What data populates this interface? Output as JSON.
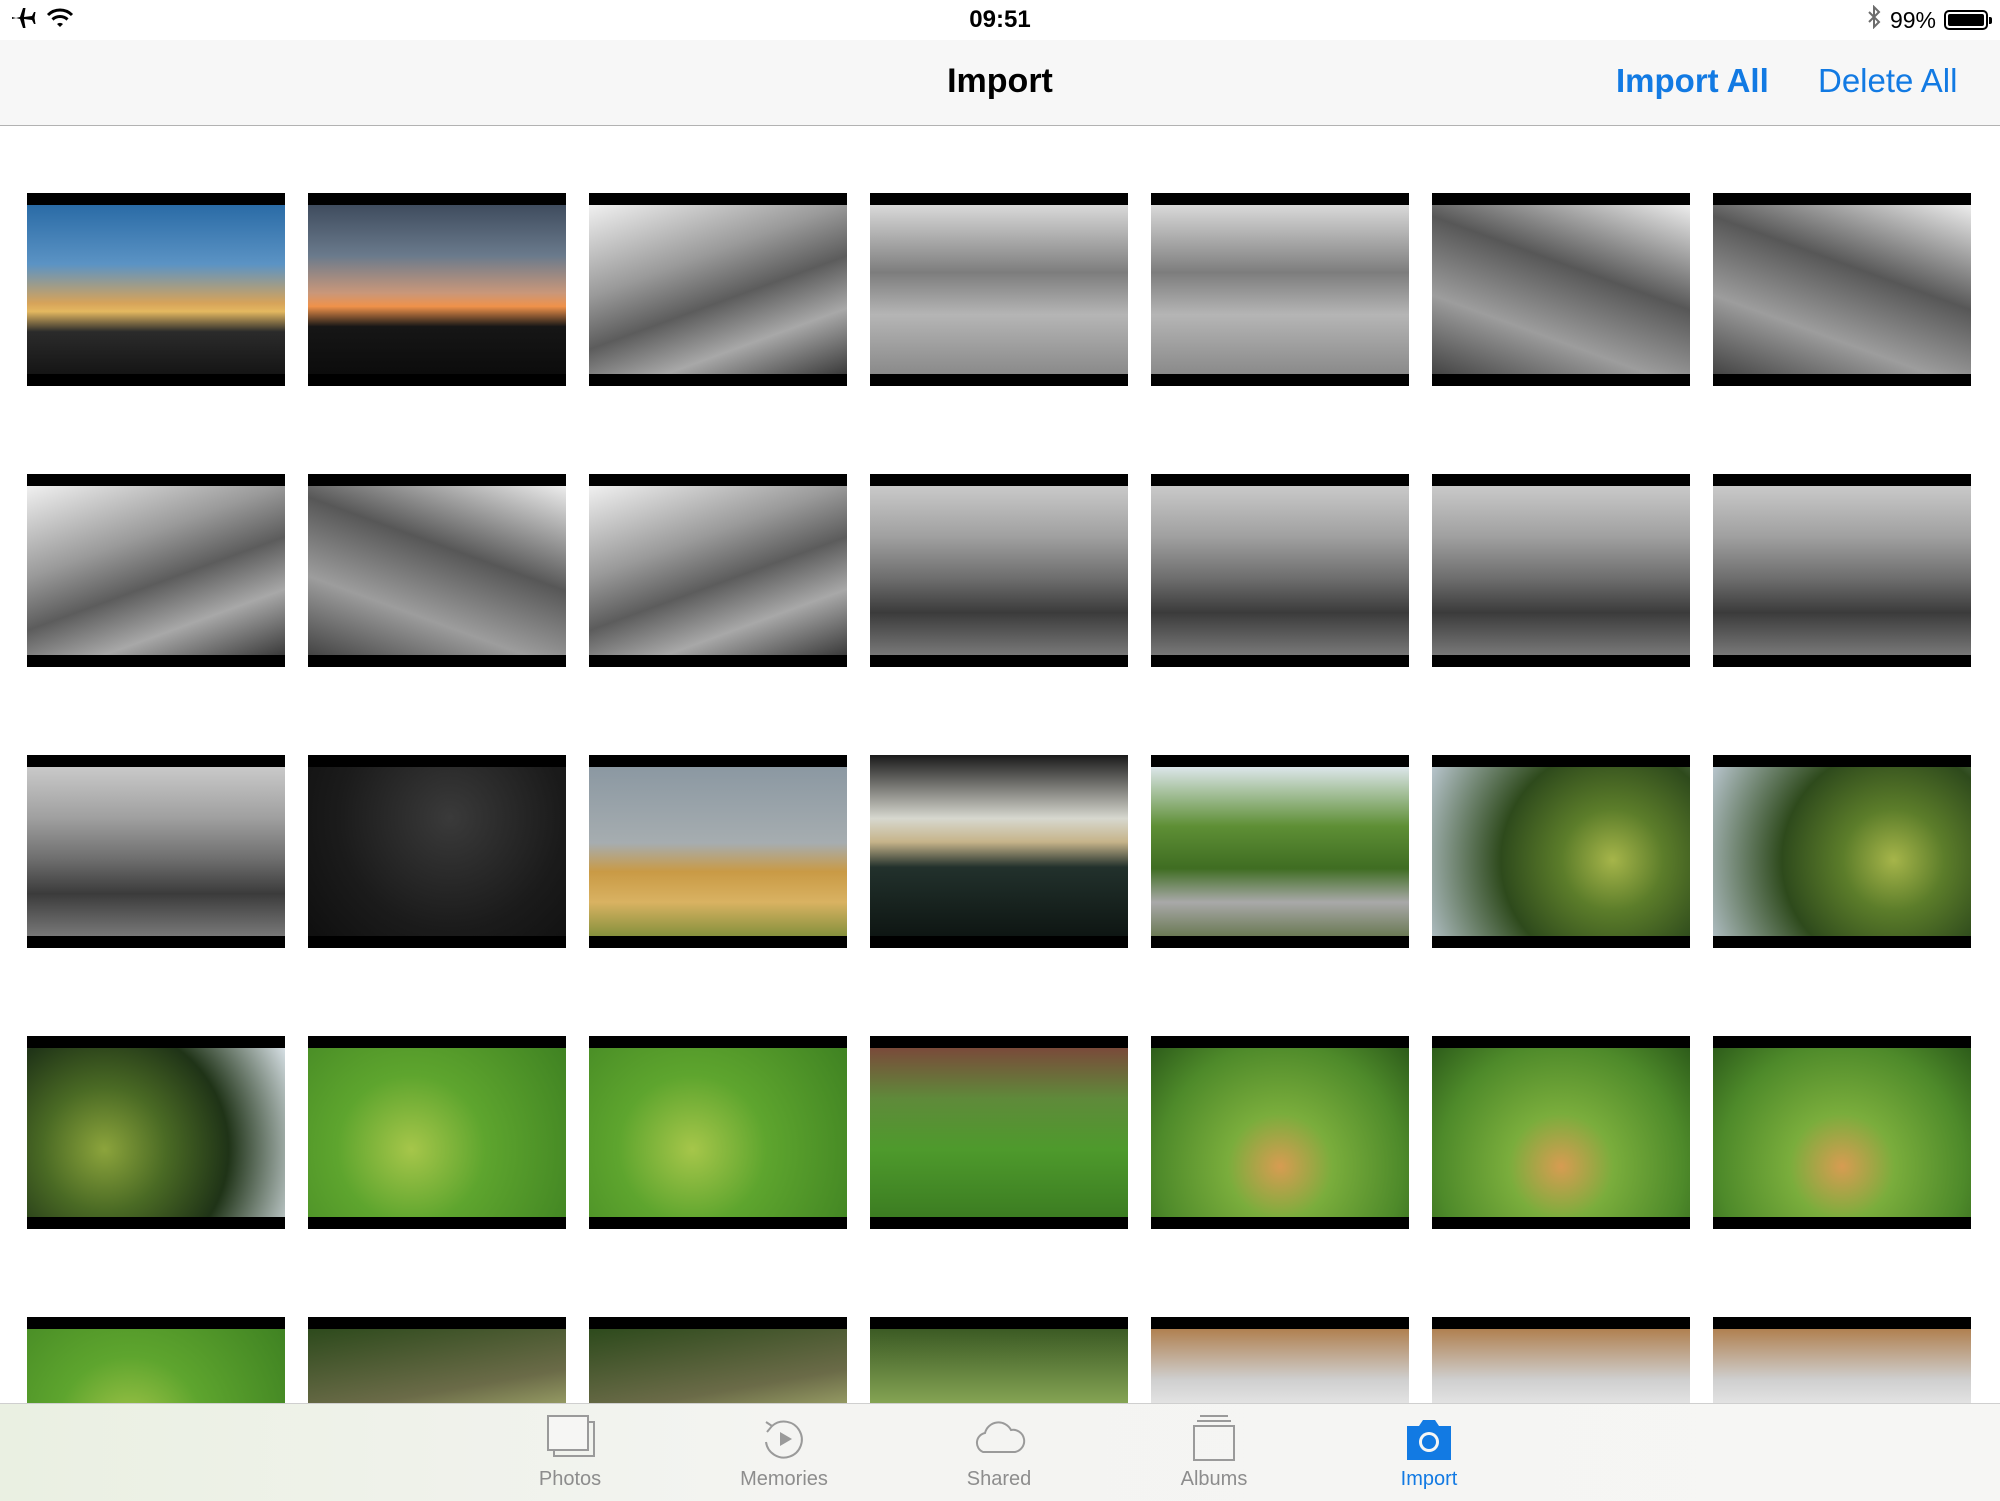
{
  "status_bar": {
    "time": "09:51",
    "battery": "99%",
    "icons": [
      "airplane-icon",
      "wifi-icon",
      "bluetooth-icon",
      "battery-icon"
    ]
  },
  "navbar": {
    "title": "Import",
    "import_all_label": "Import All",
    "delete_all_label": "Delete All",
    "accent_color": "#127ae3"
  },
  "photos": [
    {
      "style": "sunset1"
    },
    {
      "style": "sunset2"
    },
    {
      "style": "bw-street"
    },
    {
      "style": "bw-street2"
    },
    {
      "style": "bw-street2"
    },
    {
      "style": "bw-street3"
    },
    {
      "style": "bw-street3"
    },
    {
      "style": "bw-street"
    },
    {
      "style": "bw-street3"
    },
    {
      "style": "bw-street"
    },
    {
      "style": "bw-tree"
    },
    {
      "style": "bw-tree"
    },
    {
      "style": "bw-tree"
    },
    {
      "style": "bw-tree"
    },
    {
      "style": "bw-tree"
    },
    {
      "style": "dark-trees"
    },
    {
      "style": "field"
    },
    {
      "style": "car",
      "padTop": true
    },
    {
      "style": "lane"
    },
    {
      "style": "apple-tree"
    },
    {
      "style": "apple-tree"
    },
    {
      "style": "apple-tree2"
    },
    {
      "style": "grass"
    },
    {
      "style": "grass"
    },
    {
      "style": "grass2"
    },
    {
      "style": "apples-grass"
    },
    {
      "style": "apples-grass"
    },
    {
      "style": "apples-grass"
    },
    {
      "style": "grass"
    },
    {
      "style": "branch"
    },
    {
      "style": "branch"
    },
    {
      "style": "garden"
    },
    {
      "style": "box"
    },
    {
      "style": "box"
    },
    {
      "style": "box"
    }
  ],
  "tab_bar": {
    "tabs": [
      {
        "label": "Photos",
        "icon": "photos-icon",
        "active": false
      },
      {
        "label": "Memories",
        "icon": "memories-icon",
        "active": false
      },
      {
        "label": "Shared",
        "icon": "cloud-icon",
        "active": false
      },
      {
        "label": "Albums",
        "icon": "albums-icon",
        "active": false
      },
      {
        "label": "Import",
        "icon": "camera-icon",
        "active": true
      }
    ]
  }
}
